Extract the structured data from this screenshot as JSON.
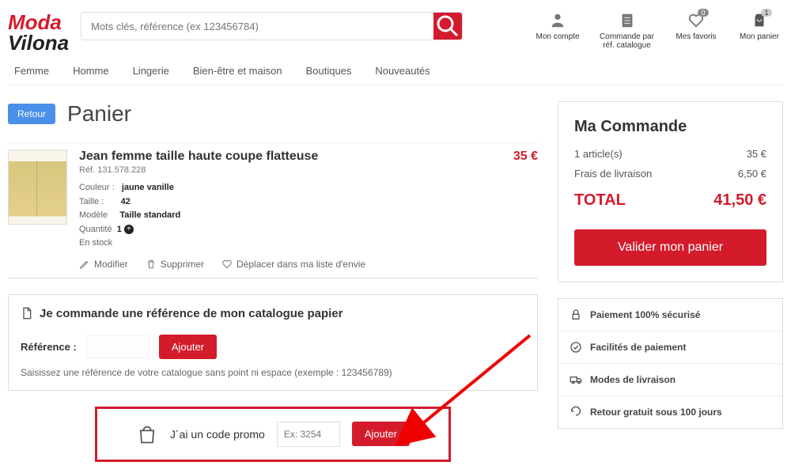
{
  "logo": {
    "line1": "Moda",
    "line2": "Vilona"
  },
  "search": {
    "placeholder": "Mots clés, référence (ex 123456784)"
  },
  "headerIcons": {
    "account": "Mon compte",
    "catalog": "Commande par réf. catalogue",
    "favorites": "Mes favoris",
    "favoritesCount": "0",
    "cart": "Mon panier",
    "cartCount": "1"
  },
  "nav": [
    "Femme",
    "Homme",
    "Lingerie",
    "Bien-être et maison",
    "Boutiques",
    "Nouveautés"
  ],
  "page": {
    "back": "Retour",
    "title": "Panier"
  },
  "item": {
    "name": "Jean femme taille haute coupe flatteuse",
    "refLabel": "Réf.",
    "ref": "131.578.228",
    "colorLabel": "Couleur :",
    "color": "jaune vanille",
    "sizeLabel": "Taille :",
    "size": "42",
    "modelLabel": "Modèle",
    "model": "Taille standard",
    "qtyLabel": "Quantité",
    "qty": "1",
    "stock": "En stock",
    "price": "35 €"
  },
  "actions": {
    "modify": "Modifier",
    "delete": "Supprimer",
    "wishlist": "Déplacer dans ma liste d'envie"
  },
  "catalog": {
    "title": "Je commande une référence de mon catalogue papier",
    "refLabel": "Référence :",
    "add": "Ajouter",
    "hint": "Saisissez une référence de votre catalogue sans point ni espace (exemple : 123456789)"
  },
  "promo": {
    "label": "J´ai un code promo",
    "placeholder": "Ex: 3254",
    "add": "Ajouter"
  },
  "order": {
    "title": "Ma Commande",
    "itemsLabel": "1 article(s)",
    "itemsValue": "35 €",
    "shipLabel": "Frais de livraison",
    "shipValue": "6,50 €",
    "totalLabel": "TOTAL",
    "totalValue": "41,50 €",
    "validate": "Valider mon panier"
  },
  "info": [
    "Paiement 100% sécurisé",
    "Facilités de paiement",
    "Modes de livraison",
    "Retour gratuit sous 100 jours"
  ]
}
